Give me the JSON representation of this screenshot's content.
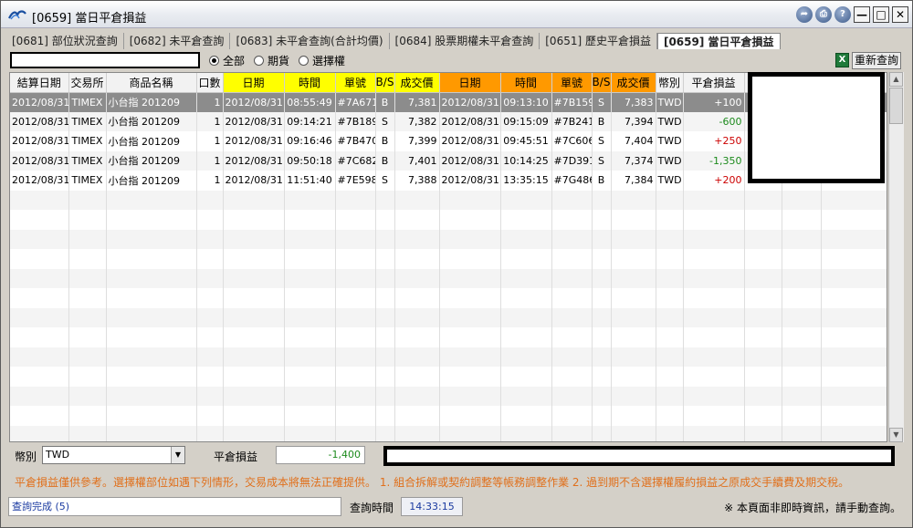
{
  "window": {
    "title": "[0659] 當日平倉損益",
    "title_buttons": [
      "➦",
      "⎙",
      "?"
    ],
    "win_controls": [
      "—",
      "□",
      "✕"
    ]
  },
  "tabs": [
    {
      "label": "[0681] 部位狀況查詢",
      "active": false
    },
    {
      "label": "[0682] 未平倉查詢",
      "active": false
    },
    {
      "label": "[0683] 未平倉查詢(合計均價)",
      "active": false
    },
    {
      "label": "[0684] 股票期權未平倉查詢",
      "active": false
    },
    {
      "label": "[0651] 歷史平倉損益",
      "active": false
    },
    {
      "label": "[0659] 當日平倉損益",
      "active": true
    }
  ],
  "filter": {
    "options": [
      {
        "label": "全部",
        "checked": true
      },
      {
        "label": "期貨",
        "checked": false
      },
      {
        "label": "選擇權",
        "checked": false
      }
    ],
    "excel_icon_text": "X",
    "requery_label": "重新查詢"
  },
  "colors": {
    "header_yellow": "#ffff00",
    "header_orange": "#ff9900",
    "profit": "#cc0000",
    "loss": "#1c8a1c",
    "note": "#e0701c"
  },
  "table": {
    "columns": [
      "結算日期",
      "交易所",
      "商品名稱",
      "口數",
      "日期",
      "時間",
      "單號",
      "B/S",
      "成交價",
      "日期",
      "時間",
      "單號",
      "B/S",
      "成交價",
      "幣別",
      "平倉損益",
      "",
      "",
      ""
    ],
    "rows": [
      [
        "2012/08/31",
        "TIMEX",
        "小台指 201209",
        "1",
        "2012/08/31",
        "08:55:49",
        "#7A671",
        "B",
        "7,381",
        "2012/08/31",
        "09:13:10",
        "#7B159",
        "S",
        "7,383",
        "TWD",
        "+100"
      ],
      [
        "2012/08/31",
        "TIMEX",
        "小台指 201209",
        "1",
        "2012/08/31",
        "09:14:21",
        "#7B189",
        "S",
        "7,382",
        "2012/08/31",
        "09:15:09",
        "#7B241",
        "B",
        "7,394",
        "TWD",
        "-600"
      ],
      [
        "2012/08/31",
        "TIMEX",
        "小台指 201209",
        "1",
        "2012/08/31",
        "09:16:46",
        "#7B470",
        "B",
        "7,399",
        "2012/08/31",
        "09:45:51",
        "#7C606",
        "S",
        "7,404",
        "TWD",
        "+250"
      ],
      [
        "2012/08/31",
        "TIMEX",
        "小台指 201209",
        "1",
        "2012/08/31",
        "09:50:18",
        "#7C682",
        "B",
        "7,401",
        "2012/08/31",
        "10:14:25",
        "#7D391",
        "S",
        "7,374",
        "TWD",
        "-1,350"
      ],
      [
        "2012/08/31",
        "TIMEX",
        "小台指 201209",
        "1",
        "2012/08/31",
        "11:51:40",
        "#7E598",
        "S",
        "7,388",
        "2012/08/31",
        "13:35:15",
        "#7G486",
        "B",
        "7,384",
        "TWD",
        "+200"
      ]
    ]
  },
  "bottom": {
    "currency_label": "幣別",
    "currency_value": "TWD",
    "pl_label": "平倉損益",
    "pl_value": "-1,400"
  },
  "note": "平倉損益僅供參考。選擇權部位如遇下列情形，交易成本將無法正確提供。 1. 組合拆解或契約調整等帳務調整作業  2. 過到期不含選擇權履約損益之原成交手續費及期交稅。",
  "status": {
    "left": "查詢完成 (5)",
    "query_time_label": "查詢時間",
    "query_time": "14:33:15",
    "right_note": "※ 本頁面非即時資訊，請手動查詢。"
  }
}
